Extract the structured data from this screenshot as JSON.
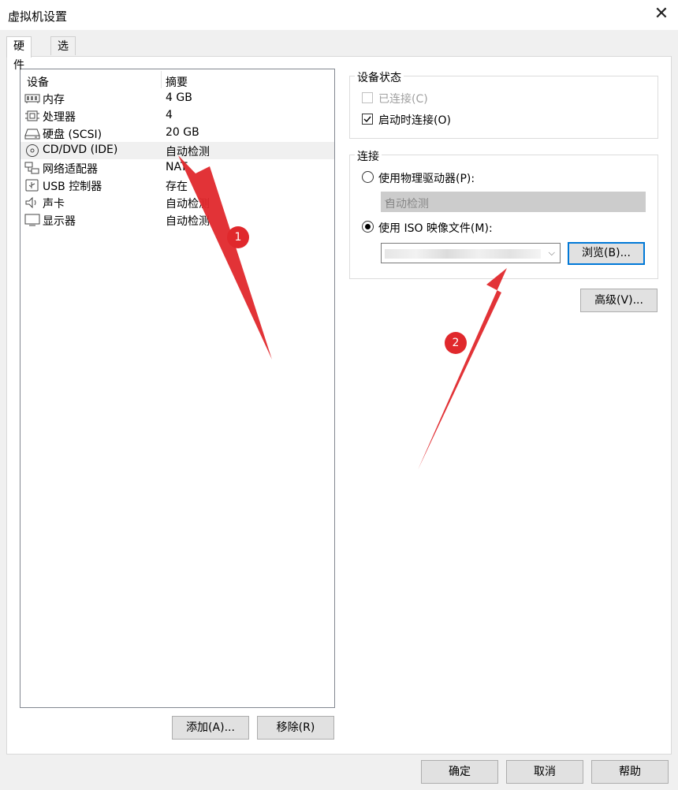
{
  "window": {
    "title": "虚拟机设置",
    "close_glyph": "✕"
  },
  "tabs": [
    {
      "label": "硬件",
      "active": true
    },
    {
      "label": "选项",
      "active": false
    }
  ],
  "device_list": {
    "columns": [
      "设备",
      "摘要"
    ],
    "rows": [
      {
        "name": "内存",
        "summary": "4 GB",
        "icon": "memory-icon"
      },
      {
        "name": "处理器",
        "summary": "4",
        "icon": "processor-icon"
      },
      {
        "name": "硬盘 (SCSI)",
        "summary": "20 GB",
        "icon": "hard-disk-icon"
      },
      {
        "name": "CD/DVD (IDE)",
        "summary": "自动检测",
        "icon": "cd-dvd-icon",
        "selected": true
      },
      {
        "name": "网络适配器",
        "summary": "NAT",
        "icon": "network-adapter-icon"
      },
      {
        "name": "USB 控制器",
        "summary": "存在",
        "icon": "usb-controller-icon"
      },
      {
        "name": "声卡",
        "summary": "自动检测",
        "icon": "sound-card-icon"
      },
      {
        "name": "显示器",
        "summary": "自动检测",
        "icon": "display-icon"
      }
    ]
  },
  "list_buttons": {
    "add": "添加(A)...",
    "remove": "移除(R)"
  },
  "device_status": {
    "title": "设备状态",
    "connected": {
      "label": "已连接(C)",
      "checked": false,
      "enabled": false
    },
    "connect_at_power_on": {
      "label": "启动时连接(O)",
      "checked": true,
      "enabled": true
    }
  },
  "connection": {
    "title": "连接",
    "physical_drive": {
      "label": "使用物理驱动器(P):",
      "selected": false
    },
    "physical_drive_value": "自动检测",
    "iso_image": {
      "label": "使用 ISO 映像文件(M):",
      "selected": true
    },
    "browse": "浏览(B)..."
  },
  "advanced": "高级(V)...",
  "footer": {
    "ok": "确定",
    "cancel": "取消",
    "help": "帮助"
  },
  "annotations": [
    {
      "number": "1"
    },
    {
      "number": "2"
    }
  ],
  "colors": {
    "annotation": "#e0282c",
    "focus": "#0078d7"
  }
}
